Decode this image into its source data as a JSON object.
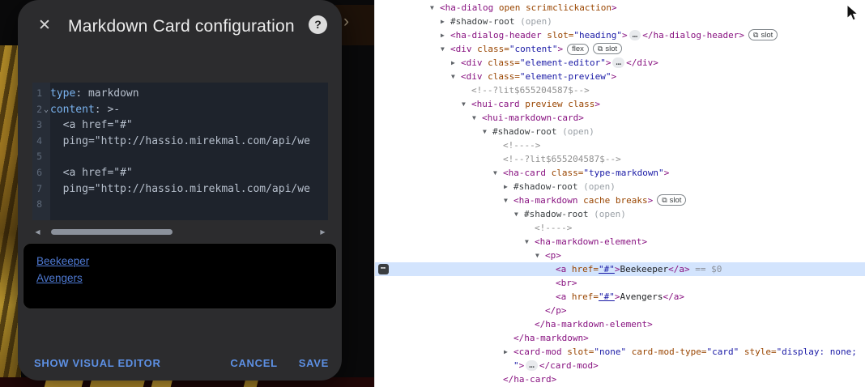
{
  "dialog": {
    "title": "Markdown Card configuration",
    "editor": {
      "lines": [
        {
          "num": "1",
          "fold": false,
          "tokens": [
            [
              "key",
              "type"
            ],
            [
              "plain",
              ": markdown"
            ]
          ]
        },
        {
          "num": "2",
          "fold": true,
          "tokens": [
            [
              "key",
              "content"
            ],
            [
              "plain",
              ": >-"
            ]
          ]
        },
        {
          "num": "3",
          "fold": false,
          "tokens": [
            [
              "plain",
              "  <a href=\"#\""
            ]
          ]
        },
        {
          "num": "4",
          "fold": false,
          "tokens": [
            [
              "plain",
              "  ping=\"http://hassio.mirekmal.com/api/we"
            ]
          ]
        },
        {
          "num": "5",
          "fold": false,
          "tokens": []
        },
        {
          "num": "6",
          "fold": false,
          "tokens": [
            [
              "plain",
              "  <a href=\"#\""
            ]
          ]
        },
        {
          "num": "7",
          "fold": false,
          "tokens": [
            [
              "plain",
              "  ping=\"http://hassio.mirekmal.com/api/we"
            ]
          ]
        },
        {
          "num": "8",
          "fold": false,
          "tokens": []
        }
      ]
    },
    "preview_links": [
      "Beekeeper",
      "Avengers"
    ],
    "actions": {
      "show_visual_editor": "SHOW VISUAL EDITOR",
      "cancel": "CANCEL",
      "save": "SAVE"
    }
  },
  "devtools": {
    "lines": [
      {
        "i": 0,
        "a": "open",
        "t": [
          [
            "tag",
            "<ha-dialog"
          ],
          [
            "attr",
            " open"
          ],
          [
            "attr",
            " scrimclickaction"
          ],
          [
            "tag",
            ">"
          ]
        ]
      },
      {
        "i": 1,
        "a": "closed",
        "t": [
          [
            "sh",
            "#shadow-root"
          ],
          [
            "par",
            " (open)"
          ]
        ]
      },
      {
        "i": 1,
        "a": "closed",
        "t": [
          [
            "tag",
            "<ha-dialog-header"
          ],
          [
            "attr",
            " slot="
          ],
          [
            "val",
            "\"heading\""
          ],
          [
            "tag",
            ">"
          ],
          [
            "ell",
            "…"
          ],
          [
            "tag",
            "</ha-dialog-header>"
          ],
          [
            "badge",
            "slot"
          ]
        ]
      },
      {
        "i": 1,
        "a": "open",
        "t": [
          [
            "tag",
            "<div"
          ],
          [
            "attr",
            " class="
          ],
          [
            "val",
            "\"content\""
          ],
          [
            "tag",
            ">"
          ],
          [
            "badge",
            "flex"
          ],
          [
            "badge",
            "slot"
          ]
        ]
      },
      {
        "i": 2,
        "a": "closed",
        "t": [
          [
            "tag",
            "<div"
          ],
          [
            "attr",
            " class="
          ],
          [
            "val",
            "\"element-editor\""
          ],
          [
            "tag",
            ">"
          ],
          [
            "ell",
            "…"
          ],
          [
            "tag",
            "</div>"
          ]
        ]
      },
      {
        "i": 2,
        "a": "open",
        "t": [
          [
            "tag",
            "<div"
          ],
          [
            "attr",
            " class="
          ],
          [
            "val",
            "\"element-preview\""
          ],
          [
            "tag",
            ">"
          ]
        ]
      },
      {
        "i": 3,
        "t": [
          [
            "com",
            "<!--?lit$655204587$-->"
          ]
        ]
      },
      {
        "i": 3,
        "a": "open",
        "t": [
          [
            "tag",
            "<hui-card"
          ],
          [
            "attr",
            " preview"
          ],
          [
            "attr",
            " class"
          ],
          [
            "tag",
            ">"
          ]
        ]
      },
      {
        "i": 4,
        "a": "open",
        "t": [
          [
            "tag",
            "<hui-markdown-card>"
          ]
        ]
      },
      {
        "i": 5,
        "a": "open",
        "t": [
          [
            "sh",
            "#shadow-root"
          ],
          [
            "par",
            " (open)"
          ]
        ]
      },
      {
        "i": 6,
        "t": [
          [
            "com",
            "<!---->"
          ]
        ]
      },
      {
        "i": 6,
        "t": [
          [
            "com",
            "<!--?lit$655204587$-->"
          ]
        ]
      },
      {
        "i": 6,
        "a": "open",
        "t": [
          [
            "tag",
            "<ha-card"
          ],
          [
            "attr",
            " class="
          ],
          [
            "val",
            "\"type-markdown\""
          ],
          [
            "tag",
            ">"
          ]
        ]
      },
      {
        "i": 7,
        "a": "closed",
        "t": [
          [
            "sh",
            "#shadow-root"
          ],
          [
            "par",
            " (open)"
          ]
        ]
      },
      {
        "i": 7,
        "a": "open",
        "t": [
          [
            "tag",
            "<ha-markdown"
          ],
          [
            "attr",
            " cache"
          ],
          [
            "attr",
            " breaks"
          ],
          [
            "tag",
            ">"
          ],
          [
            "badge",
            "slot"
          ]
        ]
      },
      {
        "i": 8,
        "a": "open",
        "t": [
          [
            "sh",
            "#shadow-root"
          ],
          [
            "par",
            " (open)"
          ]
        ]
      },
      {
        "i": 9,
        "t": [
          [
            "com",
            "<!---->"
          ]
        ]
      },
      {
        "i": 9,
        "a": "open",
        "t": [
          [
            "tag",
            "<ha-markdown-element>"
          ]
        ]
      },
      {
        "i": 10,
        "a": "open",
        "t": [
          [
            "tag",
            "<p>"
          ]
        ]
      },
      {
        "i": 11,
        "sel": true,
        "dots": true,
        "t": [
          [
            "tag",
            "<a"
          ],
          [
            "attr",
            " href="
          ],
          [
            "link",
            "\"#\""
          ],
          [
            "tag",
            ">"
          ],
          [
            "txt",
            "Beekeeper"
          ],
          [
            "tag",
            "</a>"
          ],
          [
            "dim",
            " == $0"
          ]
        ]
      },
      {
        "i": 11,
        "t": [
          [
            "tag",
            "<br>"
          ]
        ]
      },
      {
        "i": 11,
        "t": [
          [
            "tag",
            "<a"
          ],
          [
            "attr",
            " href="
          ],
          [
            "link",
            "\"#\""
          ],
          [
            "tag",
            ">"
          ],
          [
            "txt",
            "Avengers"
          ],
          [
            "tag",
            "</a>"
          ]
        ]
      },
      {
        "i": 10,
        "t": [
          [
            "tag",
            "</p>"
          ]
        ]
      },
      {
        "i": 9,
        "t": [
          [
            "tag",
            "</ha-markdown-element>"
          ]
        ]
      },
      {
        "i": 7,
        "t": [
          [
            "tag",
            "</ha-markdown>"
          ]
        ]
      },
      {
        "i": 7,
        "a": "closed",
        "t": [
          [
            "tag",
            "<card-mod"
          ],
          [
            "attr",
            " slot="
          ],
          [
            "val",
            "\"none\""
          ],
          [
            "attr",
            " card-mod-type="
          ],
          [
            "val",
            "\"card\""
          ],
          [
            "attr",
            " style="
          ],
          [
            "val",
            "\"display: none;"
          ]
        ]
      },
      {
        "i": 7,
        "t": [
          [
            "val",
            "\""
          ],
          [
            "tag",
            ">"
          ],
          [
            "ell",
            "…"
          ],
          [
            "tag",
            "</card-mod>"
          ]
        ]
      },
      {
        "i": 6,
        "t": [
          [
            "tag",
            "</ha-card>"
          ]
        ]
      }
    ]
  },
  "icons": {
    "close": "✕",
    "help": "?",
    "fold": "⌄",
    "scroll_left": "◀",
    "scroll_right": "▶",
    "expand_open": "▼",
    "expand_closed": "▶",
    "ellipsis": "…",
    "slot_badge": "⧉",
    "node_menu": "⋯",
    "chevron": "›"
  },
  "colors": {
    "accent": "#5d90e4",
    "link": "#4e79d2",
    "key": "#7ab3ef",
    "code": "#b6bfcc",
    "dlg": "#2c2c2e",
    "ed": "#1e232c",
    "gut": "#272d37",
    "tag": "#881280",
    "attr": "#994500",
    "val": "#1a1aa6",
    "com": "#8f8f8f",
    "txt": "#202124",
    "sh": "#3c4043",
    "par": "#9aa0a6",
    "dim": "#8a8f98",
    "sel": "#d3e4fd"
  }
}
